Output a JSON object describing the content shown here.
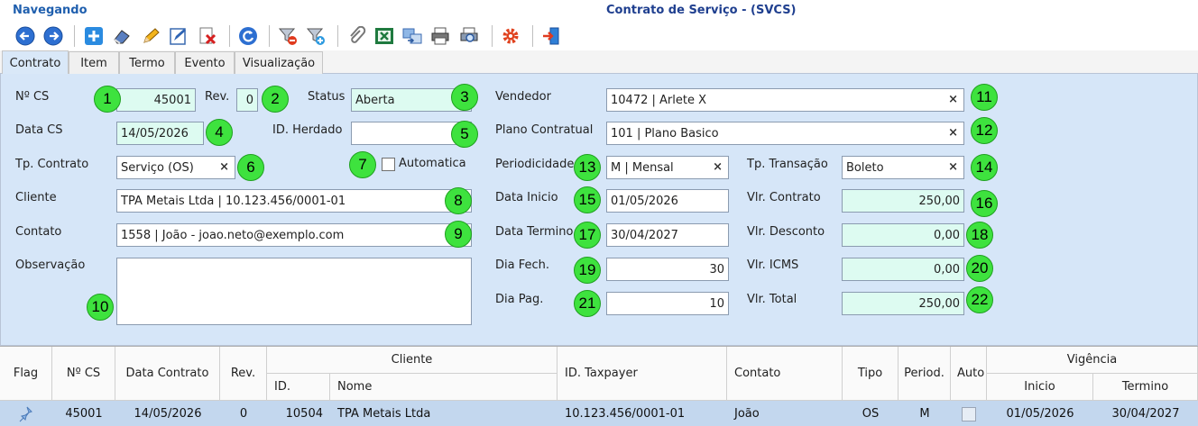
{
  "window": {
    "mode": "Navegando",
    "title": "Contrato de Serviço - (SVCS)"
  },
  "toolbar": {
    "buttons": [
      {
        "name": "back-icon"
      },
      {
        "name": "forward-icon"
      },
      {
        "name": "add-icon"
      },
      {
        "name": "eraser-icon"
      },
      {
        "name": "edit-icon"
      },
      {
        "name": "edit-form-icon"
      },
      {
        "name": "delete-icon"
      },
      {
        "name": "refresh-icon"
      },
      {
        "name": "filter-remove-icon"
      },
      {
        "name": "filter-add-icon"
      },
      {
        "name": "attach-icon"
      },
      {
        "name": "excel-icon"
      },
      {
        "name": "transfer-icon"
      },
      {
        "name": "print-icon"
      },
      {
        "name": "print-preview-icon"
      },
      {
        "name": "settings-icon"
      },
      {
        "name": "exit-icon"
      }
    ]
  },
  "tabs": [
    "Contrato",
    "Item",
    "Termo",
    "Evento",
    "Visualização"
  ],
  "form": {
    "ncs_label": "Nº CS",
    "ncs_value": "45001",
    "rev_label": "Rev.",
    "rev_value": "0",
    "status_label": "Status",
    "status_value": "Aberta",
    "vendedor_label": "Vendedor",
    "vendedor_value": "10472 | Arlete X",
    "data_cs_label": "Data CS",
    "data_cs_value": "14/05/2026",
    "id_herdado_label": "ID. Herdado",
    "id_herdado_value": "",
    "plano_label": "Plano Contratual",
    "plano_value": "101 | Plano Basico",
    "tp_contrato_label": "Tp. Contrato",
    "tp_contrato_value": "Serviço (OS)",
    "automatica_label": "Automatica",
    "periodicidade_label": "Periodicidade",
    "periodicidade_value": "M | Mensal",
    "tp_transacao_label": "Tp. Transação",
    "tp_transacao_value": "Boleto",
    "cliente_label": "Cliente",
    "cliente_value": "TPA Metais Ltda | 10.123.456/0001-01",
    "data_inicio_label": "Data Inicio",
    "data_inicio_value": "01/05/2026",
    "vlr_contrato_label": "Vlr. Contrato",
    "vlr_contrato_value": "250,00",
    "contato_label": "Contato",
    "contato_value": "1558 | João - joao.neto@exemplo.com",
    "data_termino_label": "Data Termino",
    "data_termino_value": "30/04/2027",
    "vlr_desconto_label": "Vlr. Desconto",
    "vlr_desconto_value": "0,00",
    "observacao_label": "Observação",
    "dia_fech_label": "Dia Fech.",
    "dia_fech_value": "30",
    "vlr_icms_label": "Vlr. ICMS",
    "vlr_icms_value": "0,00",
    "dia_pag_label": "Dia Pag.",
    "dia_pag_value": "10",
    "vlr_total_label": "Vlr. Total",
    "vlr_total_value": "250,00",
    "clear_glyph": "×"
  },
  "badges": [
    "1",
    "2",
    "3",
    "4",
    "5",
    "6",
    "7",
    "8",
    "9",
    "10",
    "11",
    "12",
    "13",
    "14",
    "15",
    "16",
    "17",
    "18",
    "19",
    "20",
    "21",
    "22"
  ],
  "grid": {
    "headers": {
      "flag": "Flag",
      "ncs": "Nº CS",
      "data_contrato": "Data Contrato",
      "rev": "Rev.",
      "cliente": "Cliente",
      "cliente_id": "ID.",
      "cliente_nome": "Nome",
      "id_taxpayer": "ID. Taxpayer",
      "contato": "Contato",
      "tipo": "Tipo",
      "period": "Period.",
      "auto": "Auto",
      "vigencia": "Vigência",
      "inicio": "Inicio",
      "termino": "Termino"
    },
    "rows": [
      {
        "ncs": "45001",
        "data_contrato": "14/05/2026",
        "rev": "0",
        "cliente_id": "10504",
        "cliente_nome": "TPA Metais Ltda",
        "id_taxpayer": "10.123.456/0001-01",
        "contato": "João",
        "tipo": "OS",
        "period": "M",
        "inicio": "01/05/2026",
        "termino": "30/04/2027"
      }
    ]
  }
}
